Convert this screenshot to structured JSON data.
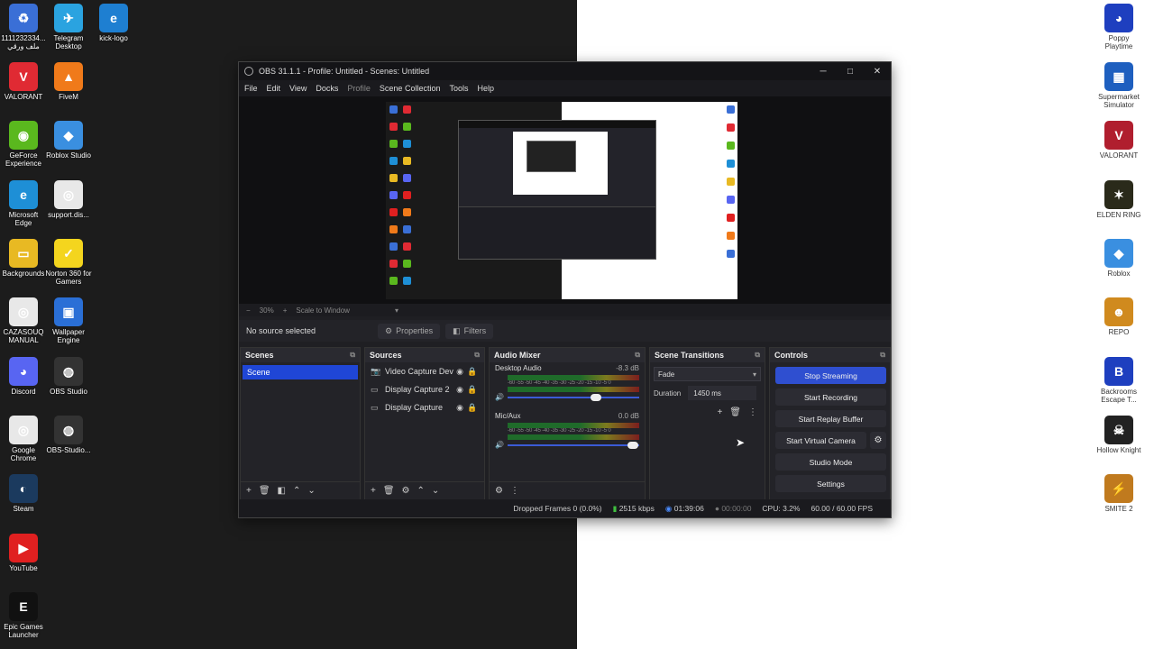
{
  "desktop_left_icons": [
    {
      "label": "1111232334...\nملف ورقي",
      "color": "#3a6fd6",
      "glyph": "♻"
    },
    {
      "label": "Telegram Desktop",
      "color": "#2aa3e0",
      "glyph": "✈"
    },
    {
      "label": "kick-logo",
      "color": "#1e7fd1",
      "glyph": "e"
    },
    {
      "label": "VALORANT",
      "color": "#e02a33",
      "glyph": "V"
    },
    {
      "label": "FiveM",
      "color": "#f07a1a",
      "glyph": "▲"
    },
    {
      "label": "GeForce Experience",
      "color": "#5ab81e",
      "glyph": "◉"
    },
    {
      "label": "Roblox Studio",
      "color": "#3a8fe0",
      "glyph": "◆"
    },
    {
      "label": "Microsoft Edge",
      "color": "#1e8fd6",
      "glyph": "e"
    },
    {
      "label": "support.dis...",
      "color": "#e8e8e8",
      "glyph": "◎"
    },
    {
      "label": "Backgrounds",
      "color": "#e8b923",
      "glyph": "▭"
    },
    {
      "label": "Norton 360 for Gamers",
      "color": "#f4d51e",
      "glyph": "✓"
    },
    {
      "label": "CAZASOUQ MANUAL",
      "color": "#e8e8e8",
      "glyph": "◎"
    },
    {
      "label": "Wallpaper Engine",
      "color": "#2a6fd6",
      "glyph": "▣"
    },
    {
      "label": "Discord",
      "color": "#5865f2",
      "glyph": "◕"
    },
    {
      "label": "OBS Studio",
      "color": "#333333",
      "glyph": "◍"
    },
    {
      "label": "Google Chrome",
      "color": "#e8e8e8",
      "glyph": "◎"
    },
    {
      "label": "OBS-Studio...",
      "color": "#333333",
      "glyph": "◍"
    },
    {
      "label": "Steam",
      "color": "#1b3a5e",
      "glyph": "◐"
    },
    {
      "label": "YouTube",
      "color": "#e02020",
      "glyph": "▶"
    },
    {
      "label": "Epic Games Launcher",
      "color": "#111111",
      "glyph": "E"
    }
  ],
  "desktop_right_icons": [
    {
      "label": "Poppy Playtime",
      "color": "#1e3fbf",
      "glyph": "◕"
    },
    {
      "label": "Supermarket Simulator",
      "color": "#1e5fbf",
      "glyph": "▦"
    },
    {
      "label": "VALORANT",
      "color": "#b01e2e",
      "glyph": "V"
    },
    {
      "label": "ELDEN RING",
      "color": "#2a2a1a",
      "glyph": "✶"
    },
    {
      "label": "Roblox",
      "color": "#3a8fe0",
      "glyph": "◆"
    },
    {
      "label": "REPO",
      "color": "#d08a1e",
      "glyph": "☻"
    },
    {
      "label": "Backrooms Escape T...",
      "color": "#1e3fbf",
      "glyph": "B"
    },
    {
      "label": "Hollow Knight",
      "color": "#222222",
      "glyph": "☠"
    },
    {
      "label": "SMITE 2",
      "color": "#c07a1e",
      "glyph": "⚡"
    }
  ],
  "window": {
    "title": "OBS 31.1.1 - Profile: Untitled - Scenes: Untitled",
    "controls": {
      "minimize": "─",
      "maximize": "□",
      "close": "✕"
    }
  },
  "menu": [
    "File",
    "Edit",
    "View",
    "Docks",
    "Profile",
    "Scene Collection",
    "Tools",
    "Help"
  ],
  "zoom": {
    "minus": "−",
    "value": "30%",
    "plus": "+",
    "scale": "Scale to Window",
    "caret": "▾"
  },
  "source_toolbar": {
    "no_source": "No source selected",
    "properties": "Properties",
    "filters": "Filters",
    "properties_icon": "⚙",
    "filters_icon": "◧"
  },
  "docks": {
    "scenes": {
      "title": "Scenes",
      "items": [
        "Scene"
      ]
    },
    "sources": {
      "title": "Sources",
      "items": [
        {
          "name": "Video Capture Dev",
          "icon": "📷"
        },
        {
          "name": "Display Capture 2",
          "icon": "▭"
        },
        {
          "name": "Display Capture",
          "icon": "▭"
        }
      ]
    },
    "mixer": {
      "title": "Audio Mixer",
      "channels": [
        {
          "name": "Desktop Audio",
          "db": "-8.3 dB",
          "volume": 0.7
        },
        {
          "name": "Mic/Aux",
          "db": "0.0 dB",
          "volume": 0.98
        }
      ],
      "ticks": "-60 -55 -50 -45 -40 -35 -30 -25 -20 -15 -10 -5 0"
    },
    "transitions": {
      "title": "Scene Transitions",
      "type": "Fade",
      "duration_label": "Duration",
      "duration_value": "1450 ms"
    },
    "controls": {
      "title": "Controls",
      "stop_streaming": "Stop Streaming",
      "start_recording": "Start Recording",
      "start_replay": "Start Replay Buffer",
      "start_virtual_cam": "Start Virtual Camera",
      "studio_mode": "Studio Mode",
      "settings": "Settings"
    }
  },
  "status": {
    "dropped": "Dropped Frames 0 (0.0%)",
    "bitrate": "2515 kbps",
    "stream_time": "01:39:06",
    "rec_time": "00:00:00",
    "cpu": "CPU: 3.2%",
    "fps": "60.00 / 60.00 FPS"
  }
}
